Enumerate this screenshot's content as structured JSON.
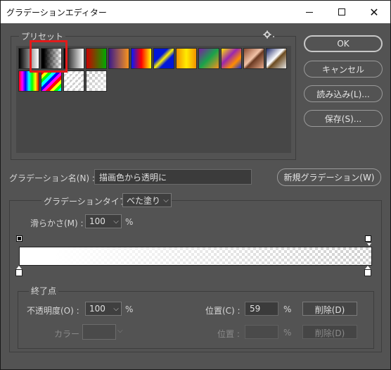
{
  "window": {
    "title": "グラデーションエディター",
    "minimize": "—",
    "maximize": "☐",
    "close": "✕"
  },
  "presets": {
    "label": "プリセット",
    "gear_icon": "gear-icon",
    "selected_index": 1,
    "swatches": [
      {
        "name": "foreground-to-background",
        "css": "linear-gradient(to right,#000,#fff)"
      },
      {
        "name": "foreground-to-transparent",
        "css": "linear-gradient(to right,#000 0%,#000 12%,rgba(255,255,255,0) 100%), repeating-conic-gradient(#cfcfcf 0 25%, #fff 0 50%) 0 0/8px 8px"
      },
      {
        "name": "black-white",
        "css": "linear-gradient(to right,#000,#fff)"
      },
      {
        "name": "red-green",
        "css": "linear-gradient(to right,#c00,#0a0)"
      },
      {
        "name": "violet-orange",
        "css": "linear-gradient(to right,#3b1b8a,#f7931e)"
      },
      {
        "name": "blue-red-yellow",
        "css": "linear-gradient(to right,#0018ff,#ff0000,#ffff00)"
      },
      {
        "name": "blue-yellow-blue",
        "css": "linear-gradient(135deg,#0017d9 0%,#0017d9 35%,#fff200 50%,#0017d9 65%,#0017d9 100%)"
      },
      {
        "name": "orange-yellow-orange",
        "css": "linear-gradient(to right,#f39200,#ffec00,#f39200)"
      },
      {
        "name": "violet-green-orange",
        "css": "linear-gradient(135deg,#7a1fa2 0%,#1aa34a 50%,#f7931e 100%)"
      },
      {
        "name": "yellow-violet-orange-blue",
        "css": "linear-gradient(135deg,#ffe600 0%,#9b27af 40%,#ff8c00 70%,#1530d8 100%)"
      },
      {
        "name": "copper",
        "css": "linear-gradient(135deg,#8c4a2f 0%,#f2c3a8 45%,#6b3a22 55%,#e7a98a 100%)"
      },
      {
        "name": "chrome",
        "css": "linear-gradient(135deg,#1d2a6b 0%,#fff 45%,#6b4a1e 55%,#e6e6e6 100%)"
      },
      {
        "name": "spectrum",
        "css": "linear-gradient(to right,#ff0000,#ff00ff,#0000ff,#00ffff,#00ff00,#ffff00,#ff0000)"
      },
      {
        "name": "transparent-rainbow",
        "css": "repeating-linear-gradient(135deg,#ff0000 0 4px,#ffff00 4px 8px,#00ff00 8px 12px,#00ffff 12px 16px,#0000ff 16px 20px,#ff00ff 20px 24px)"
      },
      {
        "name": "transparent-stripes",
        "css": "repeating-linear-gradient(135deg,rgba(255,255,255,0.9) 0 3px,rgba(0,0,0,0) 3px 6px), repeating-conic-gradient(#cfcfcf 0 25%, #fff 0 50%) 0 0/8px 8px"
      },
      {
        "name": "neutral-density",
        "css": "linear-gradient(135deg,rgba(255,255,255,0.1),rgba(255,255,255,0.6)), repeating-conic-gradient(#bcbcbc 0 25%, #fff 0 50%) 0 0/8px 8px"
      }
    ]
  },
  "buttons": {
    "ok": "OK",
    "cancel": "キャンセル",
    "load": "読み込み(L)...",
    "save": "保存(S)...",
    "new_gradient": "新規グラデーション(W)"
  },
  "name_field": {
    "label": "グラデーション名(N) :",
    "value": "描画色から透明に"
  },
  "gradient": {
    "type_label": "グラデーションタイプ :",
    "type_value": "べた塗り",
    "smoothness_label": "滑らかさ(M) :",
    "smoothness_value": "100",
    "smoothness_unit": "%"
  },
  "stops": {
    "group_label": "終了点",
    "opacity_label": "不透明度(O) :",
    "opacity_value": "100",
    "opacity_unit": "%",
    "opacity_location_label": "位置(C) :",
    "opacity_location_value": "59",
    "opacity_location_unit": "%",
    "opacity_delete": "削除(D)",
    "color_label": "カラー :",
    "color_location_label": "位置 :",
    "color_location_value": "",
    "color_location_unit": "%",
    "color_delete": "削除(D)"
  },
  "colors": {
    "bg": "#535353",
    "selection_outline": "#e21b1b"
  }
}
